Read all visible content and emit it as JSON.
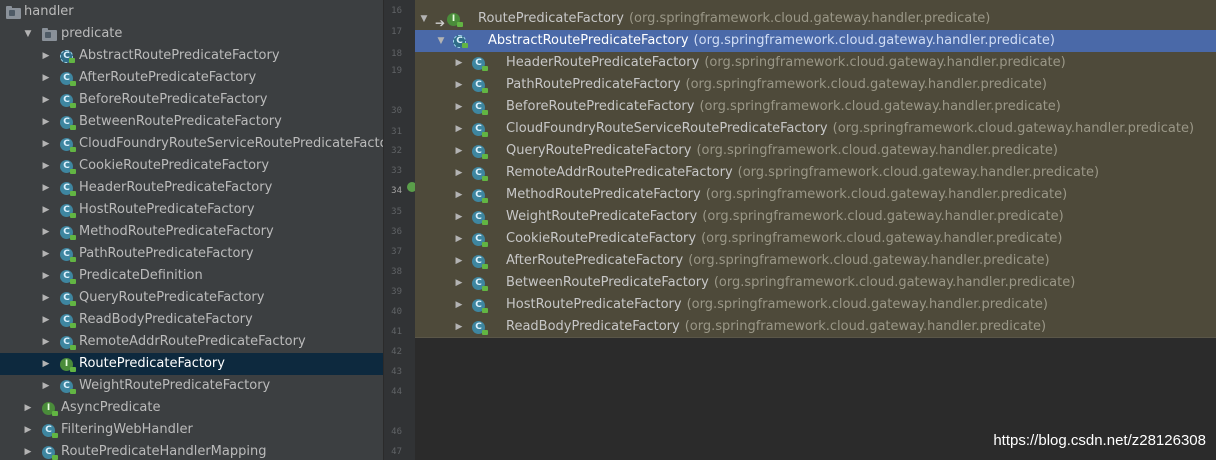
{
  "project_tree": {
    "items": [
      {
        "label": "handler",
        "kind": "package",
        "depth": 0,
        "expanded": true,
        "arrow": "",
        "selected": false
      },
      {
        "label": "predicate",
        "kind": "package",
        "depth": 1,
        "expanded": true,
        "arrow": "▼",
        "selected": false
      },
      {
        "label": "AbstractRoutePredicateFactory",
        "kind": "abstract",
        "depth": 2,
        "arrow": "▶",
        "selected": false
      },
      {
        "label": "AfterRoutePredicateFactory",
        "kind": "class",
        "depth": 2,
        "arrow": "▶",
        "selected": false
      },
      {
        "label": "BeforeRoutePredicateFactory",
        "kind": "class",
        "depth": 2,
        "arrow": "▶",
        "selected": false
      },
      {
        "label": "BetweenRoutePredicateFactory",
        "kind": "class",
        "depth": 2,
        "arrow": "▶",
        "selected": false
      },
      {
        "label": "CloudFoundryRouteServiceRoutePredicateFactory",
        "kind": "class",
        "depth": 2,
        "arrow": "▶",
        "selected": false
      },
      {
        "label": "CookieRoutePredicateFactory",
        "kind": "class",
        "depth": 2,
        "arrow": "▶",
        "selected": false
      },
      {
        "label": "HeaderRoutePredicateFactory",
        "kind": "class",
        "depth": 2,
        "arrow": "▶",
        "selected": false
      },
      {
        "label": "HostRoutePredicateFactory",
        "kind": "class",
        "depth": 2,
        "arrow": "▶",
        "selected": false
      },
      {
        "label": "MethodRoutePredicateFactory",
        "kind": "class",
        "depth": 2,
        "arrow": "▶",
        "selected": false
      },
      {
        "label": "PathRoutePredicateFactory",
        "kind": "class",
        "depth": 2,
        "arrow": "▶",
        "selected": false
      },
      {
        "label": "PredicateDefinition",
        "kind": "class",
        "depth": 2,
        "arrow": "▶",
        "selected": false
      },
      {
        "label": "QueryRoutePredicateFactory",
        "kind": "class",
        "depth": 2,
        "arrow": "▶",
        "selected": false
      },
      {
        "label": "ReadBodyPredicateFactory",
        "kind": "class",
        "depth": 2,
        "arrow": "▶",
        "selected": false
      },
      {
        "label": "RemoteAddrRoutePredicateFactory",
        "kind": "class",
        "depth": 2,
        "arrow": "▶",
        "selected": false
      },
      {
        "label": "RoutePredicateFactory",
        "kind": "interface",
        "depth": 2,
        "arrow": "▶",
        "selected": true
      },
      {
        "label": "WeightRoutePredicateFactory",
        "kind": "class",
        "depth": 2,
        "arrow": "▶",
        "selected": false
      },
      {
        "label": "AsyncPredicate",
        "kind": "interface",
        "depth": 1,
        "arrow": "▶",
        "selected": false
      },
      {
        "label": "FilteringWebHandler",
        "kind": "class",
        "depth": 1,
        "arrow": "▶",
        "selected": false
      },
      {
        "label": "RoutePredicateHandlerMapping",
        "kind": "class",
        "depth": 1,
        "arrow": "▶",
        "selected": false
      }
    ]
  },
  "gutter": {
    "line_numbers": [
      "16",
      "17",
      "18",
      "19",
      "30",
      "31",
      "32",
      "33",
      "34",
      "35",
      "36",
      "37",
      "38",
      "39",
      "40",
      "41",
      "42",
      "43",
      "44",
      "46",
      "47"
    ],
    "current_line": "34"
  },
  "hierarchy": {
    "root": {
      "class_name": "RoutePredicateFactory",
      "package": "(org.springframework.cloud.gateway.handler.predicate)",
      "kind": "interface",
      "arrow": "▼"
    },
    "selected": {
      "class_name": "AbstractRoutePredicateFactory",
      "package": "(org.springframework.cloud.gateway.handler.predicate)",
      "kind": "abstract",
      "arrow": "▼"
    },
    "children": [
      {
        "class_name": "HeaderRoutePredicateFactory",
        "package": "(org.springframework.cloud.gateway.handler.predicate)"
      },
      {
        "class_name": "PathRoutePredicateFactory",
        "package": "(org.springframework.cloud.gateway.handler.predicate)"
      },
      {
        "class_name": "BeforeRoutePredicateFactory",
        "package": "(org.springframework.cloud.gateway.handler.predicate)"
      },
      {
        "class_name": "CloudFoundryRouteServiceRoutePredicateFactory",
        "package": "(org.springframework.cloud.gateway.handler.predicate)"
      },
      {
        "class_name": "QueryRoutePredicateFactory",
        "package": "(org.springframework.cloud.gateway.handler.predicate)"
      },
      {
        "class_name": "RemoteAddrRoutePredicateFactory",
        "package": "(org.springframework.cloud.gateway.handler.predicate)"
      },
      {
        "class_name": "MethodRoutePredicateFactory",
        "package": "(org.springframework.cloud.gateway.handler.predicate)"
      },
      {
        "class_name": "WeightRoutePredicateFactory",
        "package": "(org.springframework.cloud.gateway.handler.predicate)"
      },
      {
        "class_name": "CookieRoutePredicateFactory",
        "package": "(org.springframework.cloud.gateway.handler.predicate)"
      },
      {
        "class_name": "AfterRoutePredicateFactory",
        "package": "(org.springframework.cloud.gateway.handler.predicate)"
      },
      {
        "class_name": "BetweenRoutePredicateFactory",
        "package": "(org.springframework.cloud.gateway.handler.predicate)"
      },
      {
        "class_name": "HostRoutePredicateFactory",
        "package": "(org.springframework.cloud.gateway.handler.predicate)"
      },
      {
        "class_name": "ReadBodyPredicateFactory",
        "package": "(org.springframework.cloud.gateway.handler.predicate)"
      }
    ],
    "child_arrow": "▶"
  },
  "watermark": "https://blog.csdn.net/z28126308",
  "colors": {
    "tree_bg": "#3c3f41",
    "tree_selected": "#0d293e",
    "popup_bg": "#4e4a3a",
    "popup_selected": "#4a69a8",
    "class_icon": "#3e86a0",
    "interface_icon": "#4a8c3a"
  }
}
